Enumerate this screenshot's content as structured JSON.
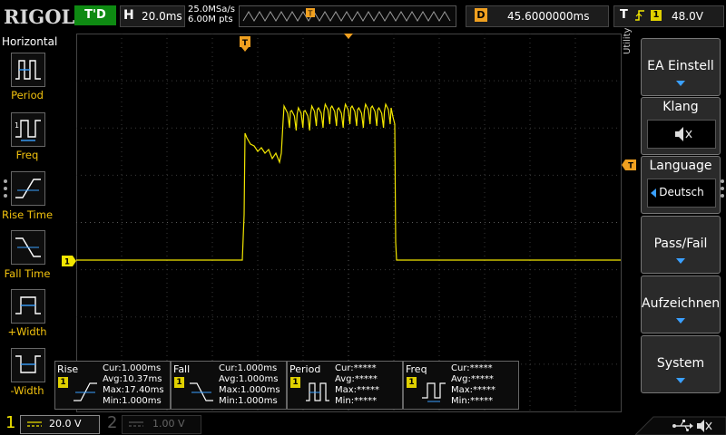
{
  "brand": "RIGOL",
  "trigger_status": "T'D",
  "timebase": {
    "label": "H",
    "value": "20.0ms"
  },
  "acquisition": {
    "sample_rate": "25.0MSa/s",
    "memory": "6.00M pts"
  },
  "delay": {
    "label": "D",
    "value": "45.6000000ms"
  },
  "trigger": {
    "label": "T",
    "source": "1",
    "level": "48.0V"
  },
  "markers": {
    "trigger_pos": "T",
    "ch1_ground": "1"
  },
  "measure_panel": {
    "title": "Horizontal",
    "items": [
      {
        "label": "Period",
        "icon": "period-icon"
      },
      {
        "label": "Freq",
        "icon": "frequency-icon"
      },
      {
        "label": "Rise Time",
        "icon": "rise-time-icon"
      },
      {
        "label": "Fall Time",
        "icon": "fall-time-icon"
      },
      {
        "label": "+Width",
        "icon": "positive-width-icon"
      },
      {
        "label": "-Width",
        "icon": "negative-width-icon"
      }
    ]
  },
  "utility_tab": "Utility",
  "menu": {
    "ea_settings": "EA Einstell",
    "sound": "Klang",
    "language": "Language",
    "language_value": "Deutsch",
    "pass_fail": "Pass/Fail",
    "record": "Aufzeichnen",
    "system": "System"
  },
  "stats": [
    {
      "name": "Rise",
      "source": "1",
      "cur": "Cur:1.000ms",
      "avg": "Avg:10.37ms",
      "max": "Max:17.40ms",
      "min": "Min:1.000ms"
    },
    {
      "name": "Fall",
      "source": "1",
      "cur": "Cur:1.000ms",
      "avg": "Avg:1.000ms",
      "max": "Max:1.000ms",
      "min": "Min:1.000ms"
    },
    {
      "name": "Period",
      "source": "1",
      "cur": "Cur:*****",
      "avg": "Avg:*****",
      "max": "Max:*****",
      "min": "Min:*****"
    },
    {
      "name": "Freq",
      "source": "1",
      "cur": "Cur:*****",
      "avg": "Avg:*****",
      "max": "Max:*****",
      "min": "Min:*****"
    }
  ],
  "channels": [
    {
      "number": "1",
      "scale": "20.0 V"
    },
    {
      "number": "2",
      "scale": "1.00 V"
    }
  ],
  "colors": {
    "ch1": "#f2e600",
    "menu_accent": "#3aa0ff",
    "trigger_orange": "#f0a020",
    "trig_state_green": "#0e8a12"
  },
  "status_icons": [
    "usb-icon",
    "speaker-muted-icon"
  ]
}
